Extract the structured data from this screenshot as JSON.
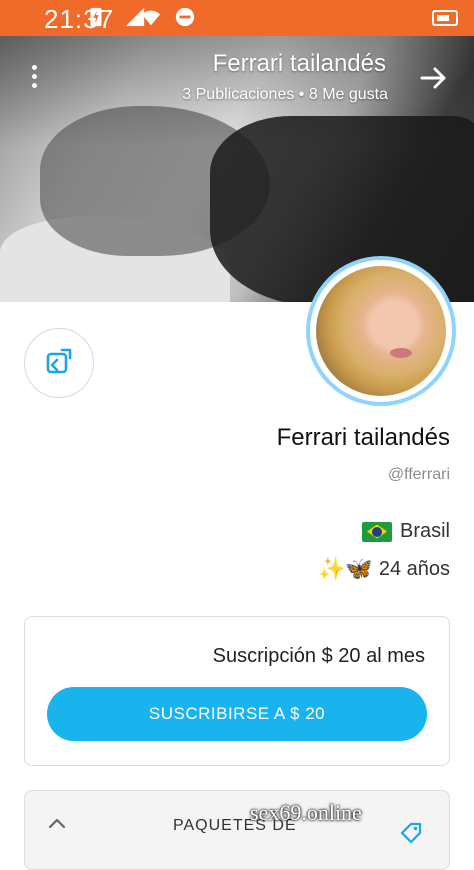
{
  "status_bar": {
    "time": "21:37",
    "battery": "98",
    "accent_color": "#f06a2a"
  },
  "header": {
    "title": "Ferrari tailandés",
    "stats": "3 Publicaciones • 8 Me gusta",
    "back_icon": "arrow-right-icon",
    "menu_icon": "more-vertical-icon"
  },
  "profile": {
    "name": "Ferrari tailandés",
    "handle": "@fferrari",
    "country": "Brasil",
    "age": "24 años",
    "age_emoji": "✨🦋",
    "share_icon": "share-icon"
  },
  "subscription": {
    "text": "Suscripción $ 20 al mes",
    "button_label": "SUSCRIBIRSE A $ 20",
    "button_color": "#19b3ee"
  },
  "packages": {
    "label": "PAQUETES DE",
    "chevron_icon": "chevron-up-icon",
    "tag_icon": "tag-icon"
  },
  "watermark": "sex69.online"
}
